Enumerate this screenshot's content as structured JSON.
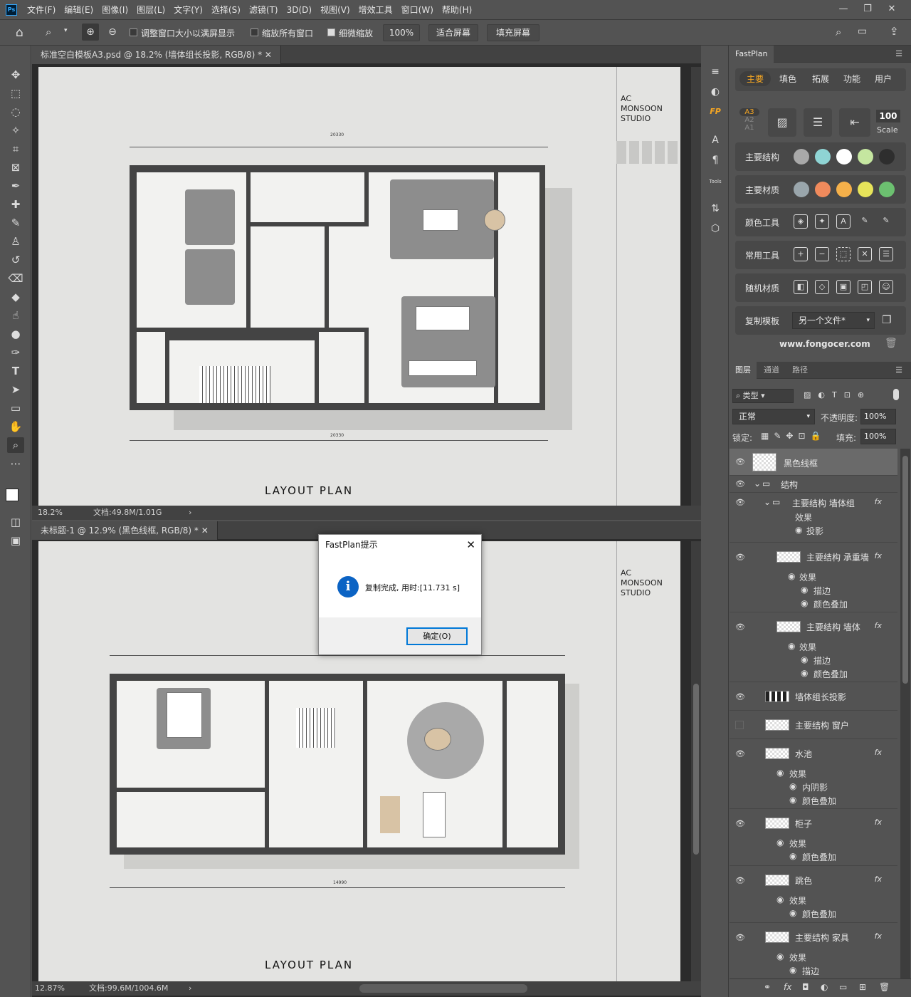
{
  "app": {
    "logo": "Ps",
    "menus": [
      "文件(F)",
      "编辑(E)",
      "图像(I)",
      "图层(L)",
      "文字(Y)",
      "选择(S)",
      "滤镜(T)",
      "3D(D)",
      "视图(V)",
      "增效工具",
      "窗口(W)",
      "帮助(H)"
    ],
    "window_controls": [
      "—",
      "❐",
      "✕"
    ]
  },
  "options": {
    "resize_windows": "调整窗口大小以满屏显示",
    "zoom_all": "缩放所有窗口",
    "scrubby_zoom": "细微缩放",
    "zoom_value": "100%",
    "fit_screen": "适合屏幕",
    "fill_screen": "填充屏幕"
  },
  "doc1": {
    "tab": "标准空白模板A3.psd @ 18.2% (墙体组长投影, RGB/8) *",
    "studio_lines": [
      "AC",
      "MONSOON",
      "STUDIO"
    ],
    "plan_title": "LAYOUT PLAN",
    "dims_top": "20330",
    "dims_bottom": "20330",
    "zoom": "18.2%",
    "docsize": "文档:49.8M/1.01G"
  },
  "doc2": {
    "tab": "未标题-1 @ 12.9% (黑色线框, RGB/8) *",
    "studio_lines": [
      "AC",
      "MONSOON",
      "STUDIO"
    ],
    "plan_title": "LAYOUT PLAN",
    "dims_bottom": "14990",
    "zoom": "12.87%",
    "docsize": "文档:99.6M/1004.6M"
  },
  "dialog": {
    "title": "FastPlan提示",
    "message": "复制完成, 用时:[11.731 s]",
    "ok": "确定(O)"
  },
  "fastplan": {
    "tab": "FastPlan",
    "nav": [
      "主要",
      "填色",
      "拓展",
      "功能",
      "用户"
    ],
    "paper_sizes": [
      "A3",
      "A2",
      "A1"
    ],
    "scale_value": "100",
    "scale_label": "Scale",
    "rows": [
      {
        "label": "主要结构",
        "colors": [
          "#a9a9a9",
          "#8fd4d4",
          "#ffffff",
          "#c5e6a0",
          "#2e2e2e"
        ]
      },
      {
        "label": "主要材质",
        "colors": [
          "#9aa6ac",
          "#f08a5c",
          "#f5b04a",
          "#e7e45a",
          "#6cc070"
        ]
      },
      {
        "label": "颜色工具",
        "icons": [
          "◈",
          "✦",
          "A",
          "✎",
          "✎"
        ]
      },
      {
        "label": "常用工具",
        "icons": [
          "+",
          "−",
          "⬚",
          "✕",
          "☰"
        ]
      },
      {
        "label": "随机材质",
        "icons": [
          "◧",
          "◇",
          "▣",
          "◰",
          "☺"
        ]
      }
    ],
    "copy_template_label": "复制模板",
    "copy_template_value": "另一个文件*",
    "website": "www.fongocer.com"
  },
  "layers": {
    "tabs": [
      "图层",
      "通道",
      "路径"
    ],
    "filter_kind": "类型",
    "blend_mode": "正常",
    "opacity_label": "不透明度:",
    "opacity": "100%",
    "lock_label": "锁定:",
    "fill_label": "填充:",
    "fill": "100%",
    "items": [
      {
        "name": "黑色线框",
        "fx": false
      },
      {
        "name": "结构",
        "fx": false
      },
      {
        "name": "主要结构 墙体组",
        "fx": true
      },
      {
        "name": "效果"
      },
      {
        "name": "投影"
      },
      {
        "name": "主要结构 承重墙",
        "fx": true
      },
      {
        "name": "效果"
      },
      {
        "name": "描边"
      },
      {
        "name": "颜色叠加"
      },
      {
        "name": "主要结构 墙体",
        "fx": true
      },
      {
        "name": "效果"
      },
      {
        "name": "描边"
      },
      {
        "name": "颜色叠加"
      },
      {
        "name": "墙体组长投影",
        "fx": false
      },
      {
        "name": "主要结构 窗户",
        "fx": false
      },
      {
        "name": "水池",
        "fx": true
      },
      {
        "name": "效果"
      },
      {
        "name": "内阴影"
      },
      {
        "name": "颜色叠加"
      },
      {
        "name": "柜子",
        "fx": true
      },
      {
        "name": "效果"
      },
      {
        "name": "颜色叠加"
      },
      {
        "name": "跳色",
        "fx": true
      },
      {
        "name": "效果"
      },
      {
        "name": "颜色叠加"
      },
      {
        "name": "主要结构 家具",
        "fx": true
      },
      {
        "name": "效果"
      },
      {
        "name": "描边"
      }
    ],
    "fx_symbol": "fx"
  },
  "side_strip": {
    "fp": "FP",
    "tools": "Tools"
  }
}
